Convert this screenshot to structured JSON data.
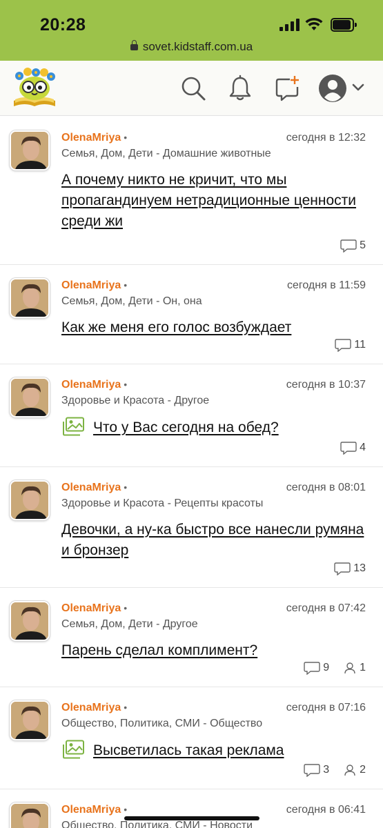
{
  "status_bar": {
    "time": "20:28"
  },
  "browser": {
    "url": "sovet.kidstaff.com.ua"
  },
  "header": {
    "logo": "book-owl-logo",
    "icons": [
      "search-icon",
      "bell-icon",
      "chat-add-icon",
      "user-avatar-icon",
      "chevron-down-icon"
    ]
  },
  "colors": {
    "accent": "#e8731c",
    "bar": "#9cc24a",
    "image_icon": "#7cb342"
  },
  "posts": [
    {
      "author": "OlenaMriya",
      "dot": "•",
      "time": "сегодня в 12:32",
      "category": "Семья, Дом, Дети - Домашние животные",
      "title": "А почему никто не кричит, что мы пропагандинуем нетрадиционные ценности среди жи",
      "comments": "5",
      "has_image": false
    },
    {
      "author": "OlenaMriya",
      "dot": "•",
      "time": "сегодня в 11:59",
      "category": "Семья, Дом, Дети - Он, она",
      "title": "Как же меня его голос возбуждает",
      "comments": "11",
      "has_image": false
    },
    {
      "author": "OlenaMriya",
      "dot": "•",
      "time": "сегодня в 10:37",
      "category": "Здоровье и Красота - Другое",
      "title": "Что у Вас сегодня на обед?",
      "comments": "4",
      "has_image": true
    },
    {
      "author": "OlenaMriya",
      "dot": "•",
      "time": "сегодня в 08:01",
      "category": "Здоровье и Красота - Рецепты красоты",
      "title": "Девочки, а ну-ка быстро все нанесли румяна и бронзер",
      "comments": "13",
      "has_image": false
    },
    {
      "author": "OlenaMriya",
      "dot": "•",
      "time": "сегодня в 07:42",
      "category": "Семья, Дом, Дети - Другое",
      "title": "Парень сделал комплимент?",
      "comments": "9",
      "participants": "1",
      "has_image": false
    },
    {
      "author": "OlenaMriya",
      "dot": "•",
      "time": "сегодня в 07:16",
      "category": "Общество, Политика, СМИ - Общество",
      "title": "Высветилась такая реклама",
      "comments": "3",
      "participants": "2",
      "has_image": true
    },
    {
      "author": "OlenaMriya",
      "dot": "•",
      "time": "сегодня в 06:41",
      "category": "Общество, Политика, СМИ - Новости",
      "title": "",
      "has_image": false
    }
  ]
}
